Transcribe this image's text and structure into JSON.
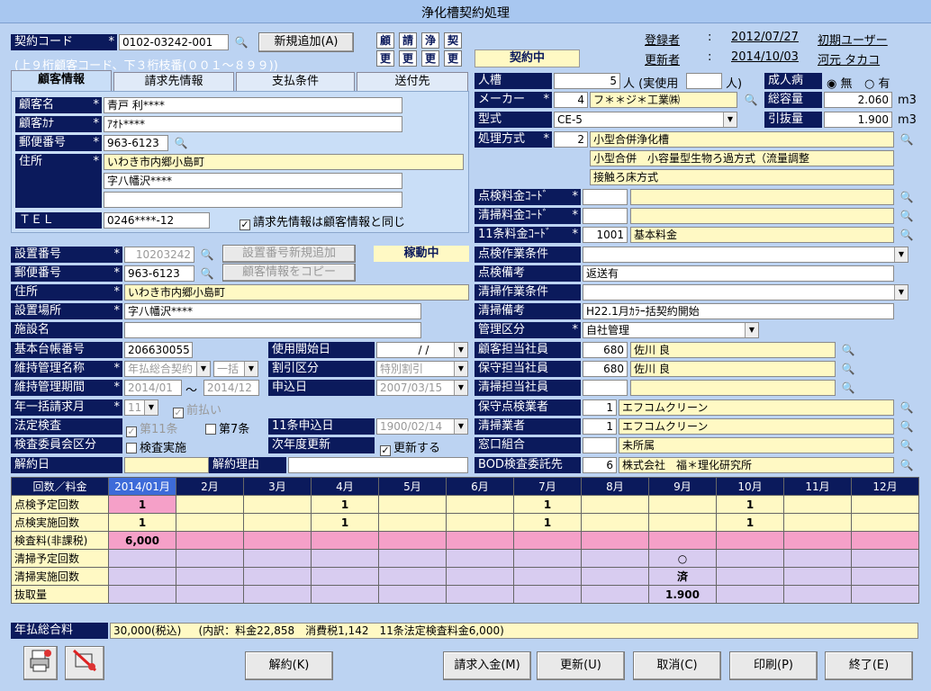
{
  "window": {
    "title": "浄化槽契約処理"
  },
  "header": {
    "contract_code_label": "契約コード",
    "contract_code": "0102-03242-001",
    "new_add": "新規追加(A)",
    "code_note": "(上９桁顧客コード、下３桁枝番(００１～８９９))",
    "badges_top": [
      "顧",
      "請",
      "浄",
      "契"
    ],
    "badges_bottom": [
      "更",
      "更",
      "更",
      "更"
    ],
    "status": "契約中",
    "registered_label": "登録者",
    "registered_date": "2012/07/27",
    "registered_by": "初期ユーザー",
    "updated_label": "更新者",
    "updated_date": "2014/10/03",
    "updated_by": "河元 タカコ",
    "colon": ":"
  },
  "tabs": [
    "顧客情報",
    "請求先情報",
    "支払条件",
    "送付先"
  ],
  "customer": {
    "name_label": "顧客名",
    "name": "青戸 利****",
    "kana_label": "顧客ｶﾅ",
    "kana": "ｱｵﾄ****",
    "zip_label": "郵便番号",
    "zip": "963-6123",
    "address_label": "住所",
    "address1": "いわき市内郷小島町",
    "address2": "字八幡沢****",
    "address3": "",
    "tel_label": "ＴＥＬ",
    "tel": "0246****-12",
    "same_check": "請求先情報は顧客情報と同じ"
  },
  "install": {
    "no_label": "設置番号",
    "no": "10203242",
    "new_no_btn": "設置番号新規追加",
    "running": "稼動中",
    "zip_label": "郵便番号",
    "zip": "963-6123",
    "copy_btn": "顧客情報をコピー",
    "address_label": "住所",
    "address": "いわき市内郷小島町",
    "place_label": "設置場所",
    "place": "字八幡沢****",
    "facility_label": "施設名",
    "facility": "",
    "ledger_label": "基本台帳番号",
    "ledger": "206630055",
    "start_label": "使用開始日",
    "start": "/  /",
    "maint_name_label": "維持管理名称",
    "maint_name": "年払総合契約",
    "maint_name2": "一括",
    "discount_label": "割引区分",
    "discount": "特別割引",
    "maint_period_label": "維持管理期間",
    "period_from": "2014/01",
    "period_sep": "～",
    "period_to": "2014/12",
    "apply_label": "申込日",
    "apply": "2007/03/15",
    "bulk_label": "年一括請求月",
    "bulk": "11",
    "prepay": "前払い",
    "legal_label": "法定検査",
    "art11": "第11条",
    "art7": "第7条",
    "art11_apply_label": "11条申込日",
    "art11_apply": "1900/02/14",
    "committee_label": "検査委員会区分",
    "committee_check": "検査実施",
    "renew_label": "次年度更新",
    "renew_check": "更新する",
    "cancel_date_label": "解約日",
    "cancel_reason_label": "解約理由"
  },
  "tank": {
    "people_label": "人槽",
    "people": "5",
    "people_unit": "人 (実使用",
    "people_unit2": "人)",
    "adult_label": "成人病",
    "none": "無",
    "yes": "有",
    "maker_label": "メーカー",
    "maker_no": "4",
    "maker": "フ＊＊ジ＊工業㈱",
    "capacity_label": "総容量",
    "capacity": "2.060",
    "m3": "m3",
    "type_label": "型式",
    "type": "CE-5",
    "pull_label": "引抜量",
    "pull": "1.900",
    "method_label": "処理方式",
    "method_no": "2",
    "method1": "小型合併浄化槽",
    "method2": "小型合併　小容量型生物ろ過方式（流量調整",
    "method3": "接触ろ床方式",
    "insp_fee_label": "点検料金ｺｰﾄﾞ",
    "clean_fee_label": "清掃料金ｺｰﾄﾞ",
    "art11_fee_label": "11条料金ｺｰﾄﾞ",
    "art11_fee_no": "1001",
    "art11_fee": "基本料金",
    "insp_cond_label": "点検作業条件",
    "insp_note_label": "点検備考",
    "insp_note": "返送有",
    "clean_cond_label": "清掃作業条件",
    "clean_note_label": "清掃備考",
    "clean_note": "H22.1月ｶﾗｰ括契約開始",
    "mgmt_label": "管理区分",
    "mgmt": "自社管理",
    "cust_staff_label": "顧客担当社員",
    "cust_staff_no": "680",
    "cust_staff": "佐川 良",
    "maint_staff_label": "保守担当社員",
    "maint_staff_no": "680",
    "maint_staff": "佐川 良",
    "clean_staff_label": "清掃担当社員",
    "inspector_label": "保守点検業者",
    "inspector_no": "1",
    "inspector": "エフコムクリーン",
    "cleaner_label": "清掃業者",
    "cleaner_no": "1",
    "cleaner": "エフコムクリーン",
    "window_label": "窓口組合",
    "window": "未所属",
    "bod_label": "BOD検査委託先",
    "bod_no": "6",
    "bod": "株式会社　福＊理化研究所"
  },
  "grid": {
    "corner": "回数／料金",
    "months": [
      "2014/01月",
      "2月",
      "3月",
      "4月",
      "5月",
      "6月",
      "7月",
      "8月",
      "9月",
      "10月",
      "11月",
      "12月"
    ],
    "rows": [
      {
        "label": "点検予定回数",
        "values": [
          "1",
          "",
          "",
          "1",
          "",
          "",
          "1",
          "",
          "",
          "1",
          "",
          ""
        ]
      },
      {
        "label": "点検実施回数",
        "values": [
          "1",
          "",
          "",
          "1",
          "",
          "",
          "1",
          "",
          "",
          "1",
          "",
          ""
        ]
      },
      {
        "label": "検査料(非課税)",
        "values": [
          "6,000",
          "",
          "",
          "",
          "",
          "",
          "",
          "",
          "",
          "",
          "",
          ""
        ]
      },
      {
        "label": "清掃予定回数",
        "values": [
          "",
          "",
          "",
          "",
          "",
          "",
          "",
          "",
          "○",
          "",
          "",
          ""
        ]
      },
      {
        "label": "清掃実施回数",
        "values": [
          "",
          "",
          "",
          "",
          "",
          "",
          "",
          "",
          "済",
          "",
          "",
          ""
        ]
      },
      {
        "label": "抜取量",
        "values": [
          "",
          "",
          "",
          "",
          "",
          "",
          "",
          "",
          "1.900",
          "",
          "",
          ""
        ]
      }
    ]
  },
  "total": {
    "label": "年払総合料",
    "value": "30,000(税込)",
    "detail": "(内訳：料金22,858　消費税1,142　11条法定検査料金6,000)"
  },
  "footer": {
    "cancel": "解約(K)",
    "invoice": "請求入金(M)",
    "update": "更新(U)",
    "abort": "取消(C)",
    "print": "印刷(P)",
    "exit": "終了(E)"
  }
}
